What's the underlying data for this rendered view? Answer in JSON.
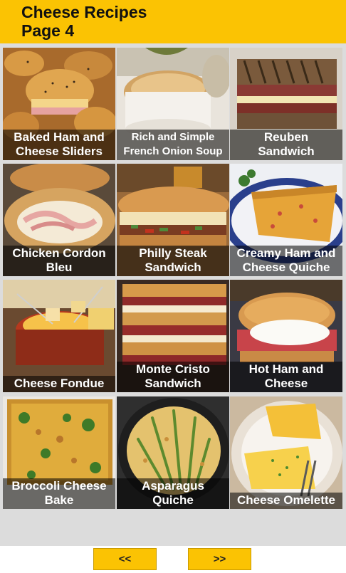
{
  "header": {
    "title": "Cheese Recipes\nPage 4"
  },
  "recipes": [
    {
      "label": "Baked Ham and\nCheese Sliders",
      "photo": "ham-cheese-sliders"
    },
    {
      "label": "Rich and Simple\nFrench Onion Soup",
      "photo": "french-onion-soup"
    },
    {
      "label": "Reuben\nSandwich",
      "photo": "reuben-sandwich"
    },
    {
      "label": "Chicken Cordon\nBleu",
      "photo": "chicken-cordon-bleu"
    },
    {
      "label": "Philly Steak\nSandwich",
      "photo": "philly-steak-sandwich"
    },
    {
      "label": "Creamy Ham and\nCheese Quiche",
      "photo": "ham-cheese-quiche"
    },
    {
      "label": "Cheese Fondue",
      "photo": "cheese-fondue"
    },
    {
      "label": "Monte Cristo\nSandwich",
      "photo": "monte-cristo-sandwich"
    },
    {
      "label": "Hot Ham and\nCheese",
      "photo": "hot-ham-cheese"
    },
    {
      "label": "Broccoli Cheese\nBake",
      "photo": "broccoli-cheese-bake"
    },
    {
      "label": "Asparagus\nQuiche",
      "photo": "asparagus-quiche"
    },
    {
      "label": "Cheese Omelette",
      "photo": "cheese-omelette"
    }
  ],
  "nav": {
    "prev_label": "<<",
    "next_label": ">>"
  },
  "colors": {
    "accent": "#fbc303",
    "grid_background": "#dcdcdc"
  }
}
